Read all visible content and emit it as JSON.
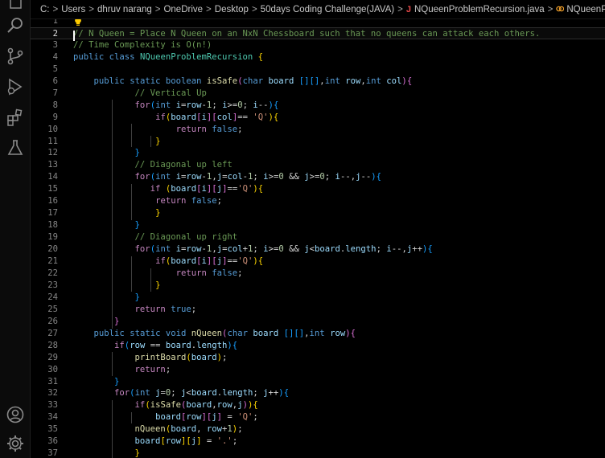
{
  "breadcrumb": {
    "drive": "C:",
    "parts": [
      "Users",
      "dhruv narang",
      "OneDrive",
      "Desktop",
      "50days Coding Challenge(JAVA)"
    ],
    "file_icon": "J",
    "file": "NQueenProblemRecursion.java",
    "symbol": "NQueenProblemRecursion"
  },
  "activity_bar": {
    "badge": "1",
    "icons": [
      "search-icon",
      "source-control-icon",
      "run-debug-icon",
      "extensions-icon",
      "testing-icon",
      "account-icon",
      "settings-gear-icon"
    ]
  },
  "editor": {
    "current_line": 2,
    "line_numbers": [
      "1",
      "2",
      "3",
      "4",
      "5",
      "6",
      "7",
      "8",
      "9",
      "10",
      "11",
      "12",
      "13",
      "14",
      "15",
      "16",
      "17",
      "18",
      "19",
      "20",
      "21",
      "22",
      "23",
      "24",
      "25",
      "26",
      "27",
      "28",
      "29",
      "30",
      "31",
      "32",
      "33",
      "34",
      "35",
      "36",
      "37"
    ],
    "lines": [
      [],
      [
        [
          "com",
          "// N Queen = Place N Queen on an NxN Chessboard such that no queens can attack each others."
        ]
      ],
      [
        [
          "com",
          "// Time Complexity is O(n!)"
        ]
      ],
      [
        [
          "kw",
          "public"
        ],
        [
          "op",
          " "
        ],
        [
          "kw",
          "class"
        ],
        [
          "op",
          " "
        ],
        [
          "ty",
          "NQueenProblemRecursion"
        ],
        [
          "op",
          " "
        ],
        [
          "b1",
          "{"
        ]
      ],
      [],
      [
        [
          "op",
          "    "
        ],
        [
          "kw",
          "public"
        ],
        [
          "op",
          " "
        ],
        [
          "kw",
          "static"
        ],
        [
          "op",
          " "
        ],
        [
          "kw",
          "boolean"
        ],
        [
          "op",
          " "
        ],
        [
          "fn",
          "isSafe"
        ],
        [
          "b2",
          "("
        ],
        [
          "kw",
          "char"
        ],
        [
          "op",
          " "
        ],
        [
          "var",
          "board"
        ],
        [
          "op",
          " "
        ],
        [
          "b3",
          "[]"
        ],
        [
          "b3",
          "[]"
        ],
        [
          "op",
          ","
        ],
        [
          "kw",
          "int"
        ],
        [
          "op",
          " "
        ],
        [
          "var",
          "row"
        ],
        [
          "op",
          ","
        ],
        [
          "kw",
          "int"
        ],
        [
          "op",
          " "
        ],
        [
          "var",
          "col"
        ],
        [
          "b2",
          ")"
        ],
        [
          "b2",
          "{"
        ]
      ],
      [
        [
          "op",
          "            "
        ],
        [
          "com",
          "// Vertical Up"
        ]
      ],
      [
        [
          "op",
          "            "
        ],
        [
          "ctl",
          "for"
        ],
        [
          "b3",
          "("
        ],
        [
          "kw",
          "int"
        ],
        [
          "op",
          " "
        ],
        [
          "var",
          "i"
        ],
        [
          "op",
          "="
        ],
        [
          "var",
          "row"
        ],
        [
          "op",
          "-"
        ],
        [
          "num",
          "1"
        ],
        [
          "op",
          "; "
        ],
        [
          "var",
          "i"
        ],
        [
          "op",
          ">="
        ],
        [
          "num",
          "0"
        ],
        [
          "op",
          "; "
        ],
        [
          "var",
          "i"
        ],
        [
          "op",
          "--"
        ],
        [
          "b3",
          ")"
        ],
        [
          "b3",
          "{"
        ]
      ],
      [
        [
          "op",
          "                "
        ],
        [
          "ctl",
          "if"
        ],
        [
          "b1",
          "("
        ],
        [
          "var",
          "board"
        ],
        [
          "b2",
          "["
        ],
        [
          "var",
          "i"
        ],
        [
          "b2",
          "]"
        ],
        [
          "b2",
          "["
        ],
        [
          "var",
          "col"
        ],
        [
          "b2",
          "]"
        ],
        [
          "op",
          "== "
        ],
        [
          "str",
          "'Q'"
        ],
        [
          "b1",
          ")"
        ],
        [
          "b1",
          "{"
        ]
      ],
      [
        [
          "op",
          "                    "
        ],
        [
          "ctl",
          "return"
        ],
        [
          "op",
          " "
        ],
        [
          "kw",
          "false"
        ],
        [
          "op",
          ";"
        ]
      ],
      [
        [
          "op",
          "                "
        ],
        [
          "b1",
          "}"
        ]
      ],
      [
        [
          "op",
          "            "
        ],
        [
          "b3",
          "}"
        ]
      ],
      [
        [
          "op",
          "            "
        ],
        [
          "com",
          "// Diagonal up left"
        ]
      ],
      [
        [
          "op",
          "            "
        ],
        [
          "ctl",
          "for"
        ],
        [
          "b3",
          "("
        ],
        [
          "kw",
          "int"
        ],
        [
          "op",
          " "
        ],
        [
          "var",
          "i"
        ],
        [
          "op",
          "="
        ],
        [
          "var",
          "row"
        ],
        [
          "op",
          "-"
        ],
        [
          "num",
          "1"
        ],
        [
          "op",
          ","
        ],
        [
          "var",
          "j"
        ],
        [
          "op",
          "="
        ],
        [
          "var",
          "col"
        ],
        [
          "op",
          "-"
        ],
        [
          "num",
          "1"
        ],
        [
          "op",
          "; "
        ],
        [
          "var",
          "i"
        ],
        [
          "op",
          ">="
        ],
        [
          "num",
          "0"
        ],
        [
          "op",
          " && "
        ],
        [
          "var",
          "j"
        ],
        [
          "op",
          ">="
        ],
        [
          "num",
          "0"
        ],
        [
          "op",
          "; "
        ],
        [
          "var",
          "i"
        ],
        [
          "op",
          "--,"
        ],
        [
          "var",
          "j"
        ],
        [
          "op",
          "--"
        ],
        [
          "b3",
          ")"
        ],
        [
          "b3",
          "{"
        ]
      ],
      [
        [
          "op",
          "               "
        ],
        [
          "ctl",
          "if"
        ],
        [
          "op",
          " "
        ],
        [
          "b1",
          "("
        ],
        [
          "var",
          "board"
        ],
        [
          "b2",
          "["
        ],
        [
          "var",
          "i"
        ],
        [
          "b2",
          "]"
        ],
        [
          "b2",
          "["
        ],
        [
          "var",
          "j"
        ],
        [
          "b2",
          "]"
        ],
        [
          "op",
          "=="
        ],
        [
          "str",
          "'Q'"
        ],
        [
          "b1",
          ")"
        ],
        [
          "b1",
          "{"
        ]
      ],
      [
        [
          "op",
          "                "
        ],
        [
          "ctl",
          "return"
        ],
        [
          "op",
          " "
        ],
        [
          "kw",
          "false"
        ],
        [
          "op",
          ";"
        ]
      ],
      [
        [
          "op",
          "                "
        ],
        [
          "b1",
          "}"
        ]
      ],
      [
        [
          "op",
          "            "
        ],
        [
          "b3",
          "}"
        ]
      ],
      [
        [
          "op",
          "            "
        ],
        [
          "com",
          "// Diagonal up right"
        ]
      ],
      [
        [
          "op",
          "            "
        ],
        [
          "ctl",
          "for"
        ],
        [
          "b3",
          "("
        ],
        [
          "kw",
          "int"
        ],
        [
          "op",
          " "
        ],
        [
          "var",
          "i"
        ],
        [
          "op",
          "="
        ],
        [
          "var",
          "row"
        ],
        [
          "op",
          "-"
        ],
        [
          "num",
          "1"
        ],
        [
          "op",
          ","
        ],
        [
          "var",
          "j"
        ],
        [
          "op",
          "="
        ],
        [
          "var",
          "col"
        ],
        [
          "op",
          "+"
        ],
        [
          "num",
          "1"
        ],
        [
          "op",
          "; "
        ],
        [
          "var",
          "i"
        ],
        [
          "op",
          ">="
        ],
        [
          "num",
          "0"
        ],
        [
          "op",
          " && "
        ],
        [
          "var",
          "j"
        ],
        [
          "op",
          "<"
        ],
        [
          "var",
          "board"
        ],
        [
          "op",
          "."
        ],
        [
          "var",
          "length"
        ],
        [
          "op",
          "; "
        ],
        [
          "var",
          "i"
        ],
        [
          "op",
          "--,"
        ],
        [
          "var",
          "j"
        ],
        [
          "op",
          "++"
        ],
        [
          "b3",
          ")"
        ],
        [
          "b3",
          "{"
        ]
      ],
      [
        [
          "op",
          "                "
        ],
        [
          "ctl",
          "if"
        ],
        [
          "b1",
          "("
        ],
        [
          "var",
          "board"
        ],
        [
          "b2",
          "["
        ],
        [
          "var",
          "i"
        ],
        [
          "b2",
          "]"
        ],
        [
          "b2",
          "["
        ],
        [
          "var",
          "j"
        ],
        [
          "b2",
          "]"
        ],
        [
          "op",
          "=="
        ],
        [
          "str",
          "'Q'"
        ],
        [
          "b1",
          ")"
        ],
        [
          "b1",
          "{"
        ]
      ],
      [
        [
          "op",
          "                    "
        ],
        [
          "ctl",
          "return"
        ],
        [
          "op",
          " "
        ],
        [
          "kw",
          "false"
        ],
        [
          "op",
          ";"
        ]
      ],
      [
        [
          "op",
          "                "
        ],
        [
          "b1",
          "}"
        ]
      ],
      [
        [
          "op",
          "            "
        ],
        [
          "b3",
          "}"
        ]
      ],
      [
        [
          "op",
          "            "
        ],
        [
          "ctl",
          "return"
        ],
        [
          "op",
          " "
        ],
        [
          "kw",
          "true"
        ],
        [
          "op",
          ";"
        ]
      ],
      [
        [
          "op",
          "        "
        ],
        [
          "b2",
          "}"
        ]
      ],
      [
        [
          "op",
          "    "
        ],
        [
          "kw",
          "public"
        ],
        [
          "op",
          " "
        ],
        [
          "kw",
          "static"
        ],
        [
          "op",
          " "
        ],
        [
          "kw",
          "void"
        ],
        [
          "op",
          " "
        ],
        [
          "fn",
          "nQueen"
        ],
        [
          "b2",
          "("
        ],
        [
          "kw",
          "char"
        ],
        [
          "op",
          " "
        ],
        [
          "var",
          "board"
        ],
        [
          "op",
          " "
        ],
        [
          "b3",
          "[]"
        ],
        [
          "b3",
          "[]"
        ],
        [
          "op",
          ","
        ],
        [
          "kw",
          "int"
        ],
        [
          "op",
          " "
        ],
        [
          "var",
          "row"
        ],
        [
          "b2",
          ")"
        ],
        [
          "b2",
          "{"
        ]
      ],
      [
        [
          "op",
          "        "
        ],
        [
          "ctl",
          "if"
        ],
        [
          "b3",
          "("
        ],
        [
          "var",
          "row"
        ],
        [
          "op",
          " == "
        ],
        [
          "var",
          "board"
        ],
        [
          "op",
          "."
        ],
        [
          "var",
          "length"
        ],
        [
          "b3",
          ")"
        ],
        [
          "b3",
          "{"
        ]
      ],
      [
        [
          "op",
          "            "
        ],
        [
          "fn",
          "printBoard"
        ],
        [
          "b1",
          "("
        ],
        [
          "var",
          "board"
        ],
        [
          "b1",
          ")"
        ],
        [
          "op",
          ";"
        ]
      ],
      [
        [
          "op",
          "            "
        ],
        [
          "ctl",
          "return"
        ],
        [
          "op",
          ";"
        ]
      ],
      [
        [
          "op",
          "        "
        ],
        [
          "b3",
          "}"
        ]
      ],
      [
        [
          "op",
          "        "
        ],
        [
          "ctl",
          "for"
        ],
        [
          "b3",
          "("
        ],
        [
          "kw",
          "int"
        ],
        [
          "op",
          " "
        ],
        [
          "var",
          "j"
        ],
        [
          "op",
          "="
        ],
        [
          "num",
          "0"
        ],
        [
          "op",
          "; "
        ],
        [
          "var",
          "j"
        ],
        [
          "op",
          "<"
        ],
        [
          "var",
          "board"
        ],
        [
          "op",
          "."
        ],
        [
          "var",
          "length"
        ],
        [
          "op",
          "; "
        ],
        [
          "var",
          "j"
        ],
        [
          "op",
          "++"
        ],
        [
          "b3",
          ")"
        ],
        [
          "b3",
          "{"
        ]
      ],
      [
        [
          "op",
          "            "
        ],
        [
          "ctl",
          "if"
        ],
        [
          "b1",
          "("
        ],
        [
          "fn",
          "isSafe"
        ],
        [
          "b2",
          "("
        ],
        [
          "var",
          "board"
        ],
        [
          "op",
          ","
        ],
        [
          "var",
          "row"
        ],
        [
          "op",
          ","
        ],
        [
          "var",
          "j"
        ],
        [
          "b2",
          ")"
        ],
        [
          "b1",
          ")"
        ],
        [
          "b1",
          "{"
        ]
      ],
      [
        [
          "op",
          "                "
        ],
        [
          "var",
          "board"
        ],
        [
          "b2",
          "["
        ],
        [
          "var",
          "row"
        ],
        [
          "b2",
          "]"
        ],
        [
          "b2",
          "["
        ],
        [
          "var",
          "j"
        ],
        [
          "b2",
          "]"
        ],
        [
          "op",
          " = "
        ],
        [
          "str",
          "'Q'"
        ],
        [
          "op",
          ";"
        ]
      ],
      [
        [
          "op",
          "            "
        ],
        [
          "fn",
          "nQueen"
        ],
        [
          "b1",
          "("
        ],
        [
          "var",
          "board"
        ],
        [
          "op",
          ", "
        ],
        [
          "var",
          "row"
        ],
        [
          "op",
          "+"
        ],
        [
          "num",
          "1"
        ],
        [
          "b1",
          ")"
        ],
        [
          "op",
          ";"
        ]
      ],
      [
        [
          "op",
          "            "
        ],
        [
          "var",
          "board"
        ],
        [
          "b1",
          "["
        ],
        [
          "var",
          "row"
        ],
        [
          "b1",
          "]"
        ],
        [
          "b1",
          "["
        ],
        [
          "var",
          "j"
        ],
        [
          "b1",
          "]"
        ],
        [
          "op",
          " = "
        ],
        [
          "str",
          "'.'"
        ],
        [
          "op",
          ";"
        ]
      ],
      [
        [
          "op",
          "            "
        ],
        [
          "b1",
          "}"
        ]
      ]
    ]
  }
}
